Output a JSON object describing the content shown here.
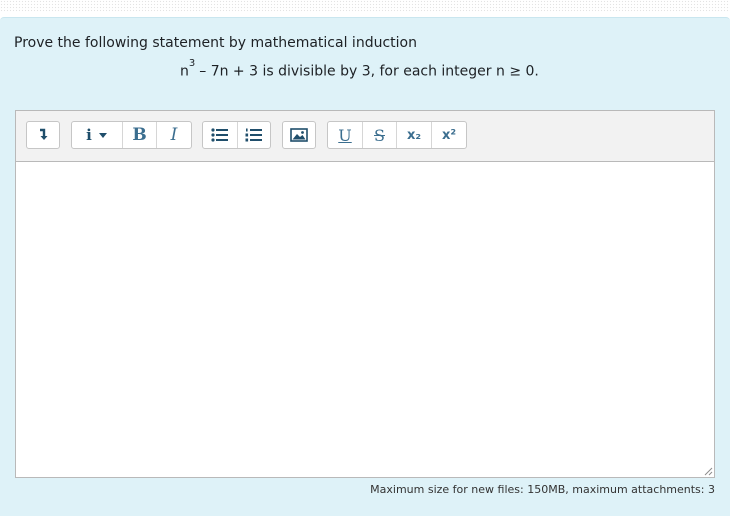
{
  "question": {
    "prompt": "Prove the following statement by mathematical induction",
    "statement_base": "n",
    "statement_exponent": "3",
    "statement_rest": "– 7n + 3 is divisible by 3, for each integer n ≥ 0."
  },
  "toolbar": {
    "expand_icon": "↳",
    "info_label": "i",
    "bold_label": "B",
    "italic_label": "I",
    "subscript_label": "x₂",
    "superscript_label": "x²",
    "underline_label": "U",
    "strike_label": "S"
  },
  "editor": {
    "value": ""
  },
  "footer": {
    "text": "Maximum size for new files: 150MB, maximum attachments: 3"
  },
  "colors": {
    "accent": "#3b6e8f",
    "question_bg": "#def2f8"
  }
}
